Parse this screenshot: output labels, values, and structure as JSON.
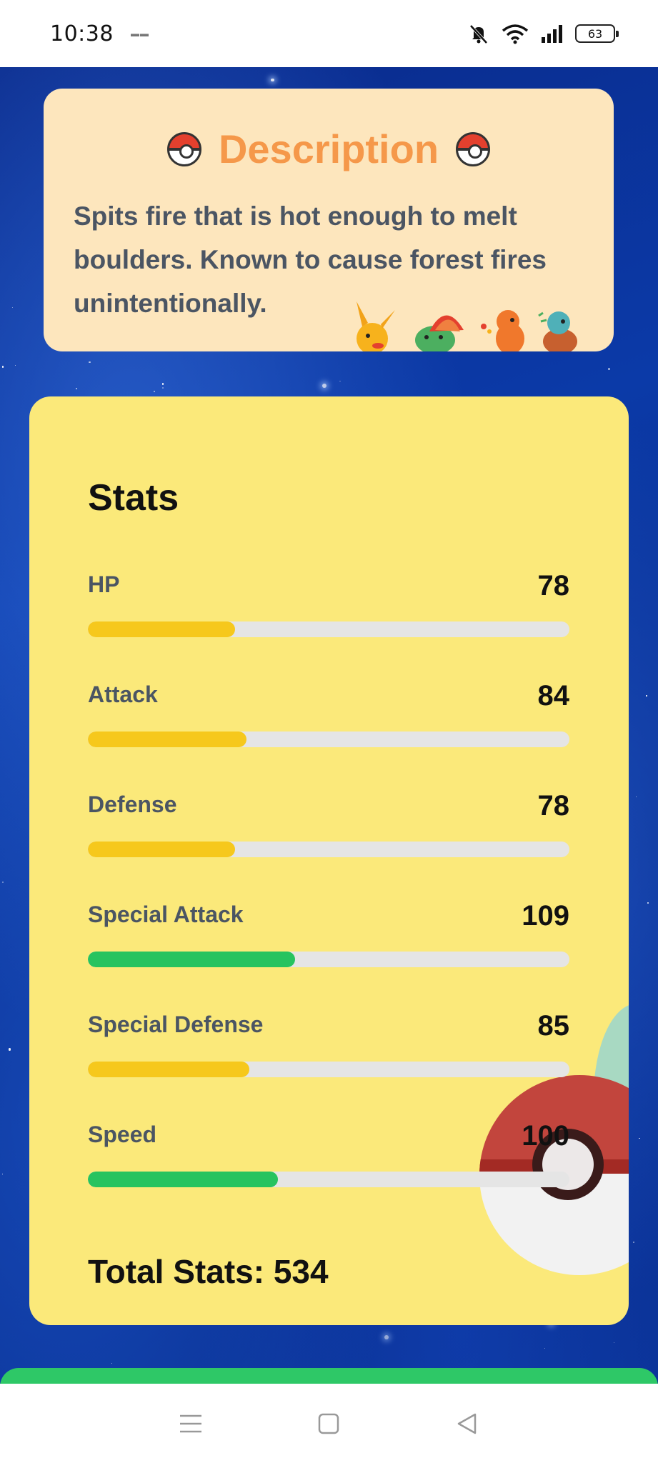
{
  "status_bar": {
    "time": "10:38",
    "battery": "63"
  },
  "description": {
    "title": "Description",
    "text": "Spits fire that is hot enough to melt boulders. Known to cause forest fires unintentionally."
  },
  "stats": {
    "title": "Stats",
    "max_value": 255,
    "items": [
      {
        "label": "HP",
        "value": 78,
        "fill_fraction": 0.305,
        "color": "#f6c81c"
      },
      {
        "label": "Attack",
        "value": 84,
        "fill_fraction": 0.33,
        "color": "#f6c81c"
      },
      {
        "label": "Defense",
        "value": 78,
        "fill_fraction": 0.305,
        "color": "#f6c81c"
      },
      {
        "label": "Special Attack",
        "value": 109,
        "fill_fraction": 0.43,
        "color": "#27c35f"
      },
      {
        "label": "Special Defense",
        "value": 85,
        "fill_fraction": 0.335,
        "color": "#f6c81c"
      },
      {
        "label": "Speed",
        "value": 100,
        "fill_fraction": 0.395,
        "color": "#27c35f"
      }
    ],
    "total_label": "Total Stats: 534"
  },
  "colors": {
    "description_bg": "#fde6bd",
    "description_title": "#f5984a",
    "stats_bg": "#fbe97a",
    "bottom_strip": "#2ec867"
  },
  "nav": {
    "icons": [
      "menu-icon",
      "home-square-icon",
      "back-triangle-icon"
    ]
  }
}
